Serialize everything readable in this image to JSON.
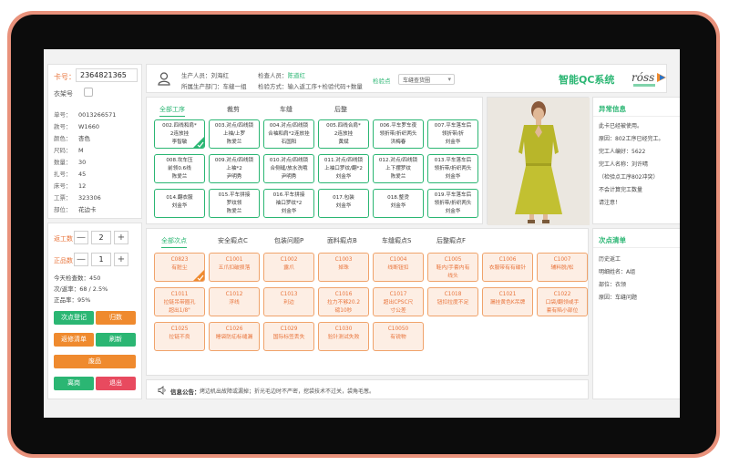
{
  "card": {
    "label": "卡号：",
    "value": "2364821365",
    "rack_label": "衣架号",
    "fields": [
      {
        "k": "单号：",
        "v": "0013266571"
      },
      {
        "k": "款号：",
        "v": "W1660"
      },
      {
        "k": "颜色：",
        "v": "杏色"
      },
      {
        "k": "尺码：",
        "v": "M"
      },
      {
        "k": "数量：",
        "v": "30"
      },
      {
        "k": "扎号：",
        "v": "45"
      },
      {
        "k": "床号：",
        "v": "12"
      },
      {
        "k": "工票：",
        "v": "323306"
      },
      {
        "k": "部位：",
        "v": "花边卡"
      }
    ]
  },
  "counts": {
    "rework_label": "返工数：",
    "rework_value": "2",
    "good_label": "正品数：",
    "good_value": "1",
    "minus": "—",
    "plus": "+",
    "stats": [
      "今天检查数：450",
      "次/返率：68 / 2.5%",
      "正品率：95%"
    ],
    "buttons": {
      "register": "次点登记",
      "return": "归数",
      "repair": "返修清单",
      "refresh": "刷新",
      "scrap": "废品",
      "leave": "离岗",
      "exit": "退出"
    }
  },
  "header": {
    "producer": "生产人员：刘海红",
    "dept": "所属生产部门：车缝一组",
    "inspector_prefix": "检查人员：",
    "inspector": "陈道红",
    "check_mode": "检验方式：输入返工序+检验代码+数量",
    "checkpoint_label": "检验点",
    "checkpoint_value": "车缝查货圈",
    "app_title": "智能QC系统",
    "logo_text": "róss",
    "logo_sub": "罗斯制衣"
  },
  "process_tabs": [
    "全部工序",
    "裁剪",
    "车缝",
    "后整"
  ],
  "processes": [
    [
      "002.四线和肩*",
      "2连放挂",
      "李智敏"
    ],
    [
      "003.对点/四线锁",
      "上袖/上罗",
      "陈爱兰"
    ],
    [
      "004.对点/四线锁",
      "合袖和肩*2连放挂",
      "石国阳"
    ],
    [
      "005.四线合肩*",
      "2连放挂",
      "黄斌"
    ],
    [
      "006.平车罗车夜",
      "领折带/折织两头",
      "洪梅春"
    ],
    [
      "007.平车落车后",
      "领折带/折",
      "刘金华"
    ],
    [
      "008.坎车压",
      "前领0.6线",
      "陈爱兰"
    ],
    [
      "009.对点/四线锁",
      "上袖*2",
      "尹明秀"
    ],
    [
      "010.对点/四线锁",
      "合侧缝/放水洗哦",
      "尹明秀"
    ],
    [
      "011.对点/四线锁",
      "上袖口罗纹/翻*2",
      "刘金华"
    ],
    [
      "012.对点/四线锁",
      "上下摆罗纹",
      "陈爱兰"
    ],
    [
      "013.平车落车后",
      "领折带/折织两头",
      "刘金华"
    ],
    [
      "014.翻衣服",
      "刘金华"
    ],
    [
      "015.平车拼接",
      "罗纹领",
      "陈爱兰"
    ],
    [
      "016.平车拼接",
      "袖口罗纹*2",
      "刘金华"
    ],
    [
      "017.包装",
      "刘金华"
    ],
    [
      "018.整烫",
      "刘金华"
    ],
    [
      "019.平车落车后",
      "领折带/折织两头",
      "刘金华"
    ]
  ],
  "defect_tabs": [
    "全部次点",
    "安全瘕点C",
    "包装问题P",
    "面料瘕点B",
    "车缝瘕点S",
    "后整瘕点F"
  ],
  "defects": [
    [
      "C0823",
      "有脏尘"
    ],
    [
      "C1001",
      "五爪扣破损落"
    ],
    [
      "C1002",
      "露爪"
    ],
    [
      "C1003",
      "掉珠"
    ],
    [
      "C1004",
      "线断钮扣"
    ],
    [
      "C1005",
      "鞋内/手套内有",
      "线头"
    ],
    [
      "C1006",
      "衣服带有有碟针"
    ],
    [
      "C1007",
      "辅料脱/松"
    ],
    [
      "C1011",
      "拉链吊带圈孔",
      "超出1/8\""
    ],
    [
      "C1012",
      "浮线"
    ],
    [
      "C1013",
      "利边"
    ],
    [
      "C1016",
      "拉力不够20.2",
      "磅10秒"
    ],
    [
      "C1017",
      "超出CPSC尺",
      "寸公差"
    ],
    [
      "C1018",
      "钮扣拉度不足"
    ],
    [
      "C1021",
      "漏挂黄色K吊牌"
    ],
    [
      "C1022",
      "口袋/翻领或手",
      "套有陷小部位"
    ],
    [
      "C1025",
      "拉链不良"
    ],
    [
      "C1026",
      "睡袋防疝标缝漏"
    ],
    [
      "C1029",
      "国际标签丢失"
    ],
    [
      "C1030",
      "验针测试失败"
    ],
    [
      "C10050",
      "有锐物"
    ]
  ],
  "exceptions": {
    "title": "异常信息",
    "lines": [
      "此卡已经被使用。",
      "原因：802工序已经完工。",
      "完工人编好：5622",
      "完工人名称：刘许晴",
      "（检验点工序802冲突）",
      "不会计算完工数量",
      "请注意！"
    ]
  },
  "history": {
    "title": "次点清单",
    "lines": [
      "历史返工",
      "明细姓名：A组",
      "部位：衣领",
      "原因：车缝问题"
    ]
  },
  "notice": {
    "label": "信息公告：",
    "text": "烤边机出故障或漏掉；折光毛边时不严密，挖袋技术不过关，袋角毛葱。"
  },
  "colors": {
    "accent": "#2bb673",
    "warning": "#ef8a2e",
    "danger": "#e84a5f",
    "frame": "#e9927c"
  }
}
